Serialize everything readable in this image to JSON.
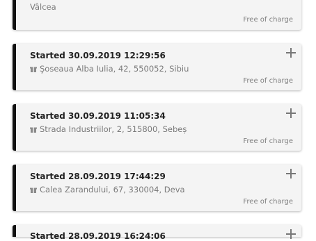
{
  "cards": [
    {
      "title": "",
      "address": "Vâlcea",
      "price": "Free of charge"
    },
    {
      "title": "Started 30.09.2019 12:29:56",
      "address": "Şoseaua Alba Iulia, 42, 550052, Sibiu",
      "price": "Free of charge"
    },
    {
      "title": "Started 30.09.2019 11:05:34",
      "address": "Strada Industriilor, 2, 515800, Sebeș",
      "price": "Free of charge"
    },
    {
      "title": "Started 28.09.2019 17:44:29",
      "address": "Calea Zarandului, 67, 330004, Deva",
      "price": "Free of charge"
    },
    {
      "title": "Started 28.09.2019 16:24:06",
      "address": "",
      "price": ""
    }
  ],
  "icons": {
    "gift": "gift-icon",
    "expand": "plus-icon"
  }
}
